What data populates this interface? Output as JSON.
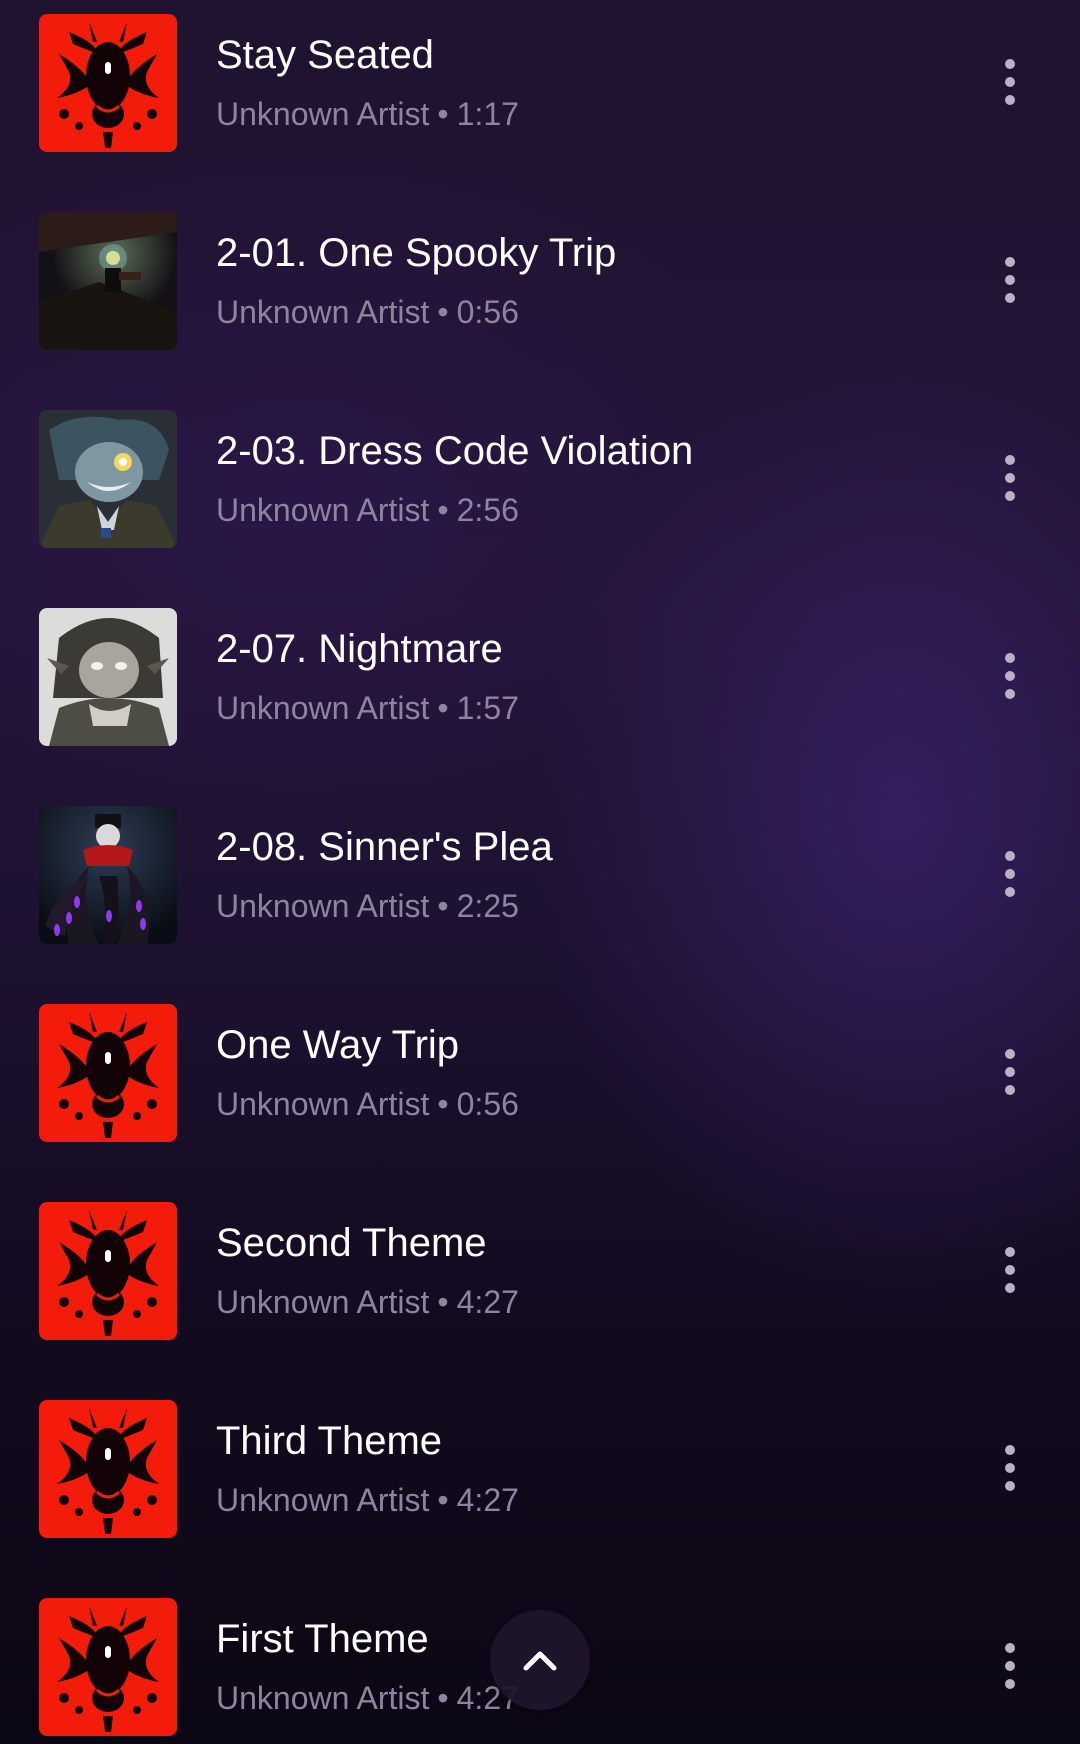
{
  "tracks": [
    {
      "title": "Stay Seated",
      "artist": "Unknown Artist",
      "separator": "•",
      "duration": "1:17",
      "art": "red-ink-art"
    },
    {
      "title": "2-01. One Spooky Trip",
      "artist": "Unknown Artist",
      "separator": "•",
      "duration": "0:56",
      "art": "dark-lantern-art"
    },
    {
      "title": "2-03. Dress Code Violation",
      "artist": "Unknown Artist",
      "separator": "•",
      "duration": "2:56",
      "art": "grinning-character-art"
    },
    {
      "title": "2-07. Nightmare",
      "artist": "Unknown Artist",
      "separator": "•",
      "duration": "1:57",
      "art": "sketch-character-art"
    },
    {
      "title": "2-08. Sinner's Plea",
      "artist": "Unknown Artist",
      "separator": "•",
      "duration": "2:25",
      "art": "tentacle-figure-art"
    },
    {
      "title": "One Way Trip",
      "artist": "Unknown Artist",
      "separator": "•",
      "duration": "0:56",
      "art": "red-ink-art"
    },
    {
      "title": "Second Theme",
      "artist": "Unknown Artist",
      "separator": "•",
      "duration": "4:27",
      "art": "red-ink-art"
    },
    {
      "title": "Third Theme",
      "artist": "Unknown Artist",
      "separator": "•",
      "duration": "4:27",
      "art": "red-ink-art"
    },
    {
      "title": "First Theme",
      "artist": "Unknown Artist",
      "separator": "•",
      "duration": "4:27",
      "art": "red-ink-art"
    }
  ],
  "icons": {
    "more": "more-vertical-icon",
    "scroll_top": "chevron-up-icon"
  },
  "colors": {
    "title": "#ffffff",
    "subtitle": "#8d84a0",
    "red_art": "#f31c0a",
    "icon": "#b9b2c6"
  }
}
